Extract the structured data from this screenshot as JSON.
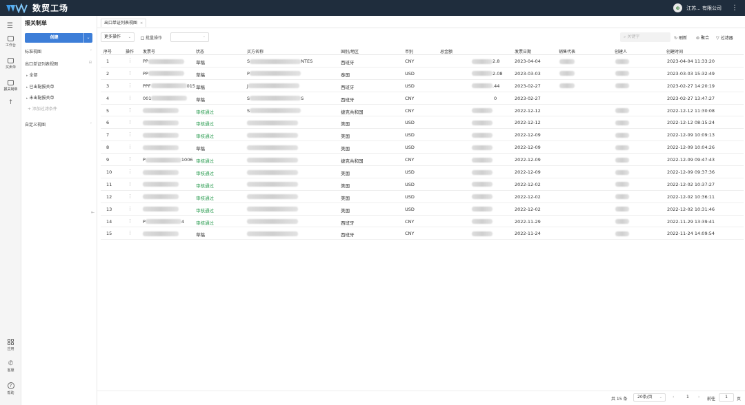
{
  "app": {
    "brand_name": "数贸工场",
    "avatar_glyph": "⊛",
    "company_name": "江苏... 有限公司",
    "colors": {
      "topbar": "#1f2d3d",
      "primary": "#3d7ed8",
      "approved": "#2f9e54"
    }
  },
  "iconbar": {
    "menu_icon": "hamburger-icon",
    "items": [
      {
        "label": "工作台",
        "icon": "workbench-icon"
      },
      {
        "label": "买卖单",
        "icon": "orders-icon"
      },
      {
        "label": "报关制单",
        "icon": "customs-icon"
      }
    ],
    "bottom": [
      {
        "label": "应用",
        "icon": "apps-grid-icon"
      },
      {
        "label": "客服",
        "icon": "phone-icon"
      },
      {
        "label": "帮助",
        "icon": "help-icon"
      }
    ]
  },
  "sidebar": {
    "title": "报关制单",
    "create_label": "创建",
    "standard_view": "标准视图",
    "export_view": "出口单证列表视图",
    "sub_items": [
      "全部",
      "已出配报关单",
      "未出配报关单"
    ],
    "add_filter": "+ 添加过滤条件",
    "custom_view": "自定义视图"
  },
  "tabs": [
    {
      "label": "出口单证列表视图",
      "close": "×"
    }
  ],
  "toolbar": {
    "more_ops": "更多操作",
    "batch_ops": "批量操作",
    "search_placeholder": "关键字",
    "refresh": "刷新",
    "stack": "聚合",
    "filter": "过滤器"
  },
  "table": {
    "columns": [
      "序号",
      "操作",
      "发票号",
      "状态",
      "买方名称",
      "国别/地区",
      "币别",
      "总金额",
      "发票日期",
      "销售代表",
      "创建人",
      "创建时间"
    ],
    "rows": [
      {
        "no": "1",
        "invoice": "PP",
        "status": "草稿",
        "approved": false,
        "buyer": "S",
        "buyer_tail": "NTES",
        "country": "西班牙",
        "currency": "CNY",
        "amount": "",
        "amount_tail": "2.8",
        "date": "2023-04-04",
        "rep": true,
        "creator": true,
        "created": "2023-04-04 11:33:20"
      },
      {
        "no": "2",
        "invoice": "PP",
        "status": "草稿",
        "approved": false,
        "buyer": "P",
        "buyer_tail": "",
        "country": "泰国",
        "currency": "USD",
        "amount": "",
        "amount_tail": "2.08",
        "date": "2023-03-03",
        "rep": true,
        "creator": true,
        "created": "2023-03-03 15:32:49"
      },
      {
        "no": "3",
        "invoice": "PPF",
        "invoice_tail": "015",
        "status": "草稿",
        "approved": false,
        "buyer": "J",
        "buyer_tail": "",
        "country": "西班牙",
        "currency": "USD",
        "amount": "",
        "amount_tail": ".44",
        "date": "2023-02-27",
        "rep": true,
        "creator": true,
        "created": "2023-02-27 14:20:19"
      },
      {
        "no": "4",
        "invoice": "001",
        "status": "草稿",
        "approved": false,
        "buyer": "S",
        "buyer_tail": "S",
        "country": "西班牙",
        "currency": "CNY",
        "amount": "0",
        "date": "2023-02-27",
        "rep": false,
        "creator": false,
        "created": "2023-02-27 13:47:27"
      },
      {
        "no": "5",
        "invoice": "",
        "status": "审核通过",
        "approved": true,
        "buyer": "S",
        "buyer_tail": "",
        "country": "捷克共和国",
        "currency": "CNY",
        "amount": "",
        "date": "2022-12-12",
        "rep": false,
        "creator": true,
        "created": "2022-12-12 11:30:08"
      },
      {
        "no": "6",
        "invoice": "",
        "status": "审核通过",
        "approved": true,
        "buyer": "",
        "buyer_tail": "",
        "country": "美国",
        "currency": "USD",
        "amount": "",
        "date": "2022-12-12",
        "rep": false,
        "creator": true,
        "created": "2022-12-12 08:15:24"
      },
      {
        "no": "7",
        "invoice": "",
        "status": "审核通过",
        "approved": true,
        "buyer": "",
        "buyer_tail": "",
        "country": "美国",
        "currency": "USD",
        "amount": "",
        "date": "2022-12-09",
        "rep": false,
        "creator": true,
        "created": "2022-12-09 10:09:13"
      },
      {
        "no": "8",
        "invoice": "",
        "status": "草稿",
        "approved": false,
        "buyer": "",
        "buyer_tail": "",
        "country": "美国",
        "currency": "USD",
        "amount": "",
        "date": "2022-12-09",
        "rep": false,
        "creator": true,
        "created": "2022-12-09 10:04:26"
      },
      {
        "no": "9",
        "invoice": "P",
        "invoice_tail": "1006",
        "status": "审核通过",
        "approved": true,
        "buyer": "",
        "buyer_tail": "",
        "country": "捷克共和国",
        "currency": "CNY",
        "amount": "",
        "date": "2022-12-09",
        "rep": false,
        "creator": true,
        "created": "2022-12-09 09:47:43"
      },
      {
        "no": "10",
        "invoice": "",
        "status": "审核通过",
        "approved": true,
        "buyer": "",
        "buyer_tail": "",
        "country": "美国",
        "currency": "USD",
        "amount": "",
        "date": "2022-12-09",
        "rep": false,
        "creator": true,
        "created": "2022-12-09 09:37:36"
      },
      {
        "no": "11",
        "invoice": "",
        "status": "审核通过",
        "approved": true,
        "buyer": "",
        "buyer_tail": "",
        "country": "美国",
        "currency": "USD",
        "amount": "",
        "date": "2022-12-02",
        "rep": false,
        "creator": true,
        "created": "2022-12-02 10:37:27"
      },
      {
        "no": "12",
        "invoice": "",
        "status": "审核通过",
        "approved": true,
        "buyer": "",
        "buyer_tail": "",
        "country": "美国",
        "currency": "USD",
        "amount": "",
        "date": "2022-12-02",
        "rep": false,
        "creator": true,
        "created": "2022-12-02 10:36:11"
      },
      {
        "no": "13",
        "invoice": "",
        "status": "审核通过",
        "approved": true,
        "buyer": "",
        "buyer_tail": "",
        "country": "美国",
        "currency": "USD",
        "amount": "",
        "date": "2022-12-02",
        "rep": false,
        "creator": true,
        "created": "2022-12-02 10:31:46"
      },
      {
        "no": "14",
        "invoice": "P",
        "invoice_tail": "4",
        "status": "审核通过",
        "approved": true,
        "buyer": "",
        "buyer_tail": "",
        "country": "西班牙",
        "currency": "CNY",
        "amount": "",
        "date": "2022-11-29",
        "rep": false,
        "creator": true,
        "created": "2022-11-29 13:39:41"
      },
      {
        "no": "15",
        "invoice": "",
        "status": "草稿",
        "approved": false,
        "buyer": "",
        "buyer_tail": "",
        "country": "西班牙",
        "currency": "CNY",
        "amount": "",
        "date": "2022-11-24",
        "rep": false,
        "creator": true,
        "created": "2022-11-24 14:09:54"
      }
    ]
  },
  "pagination": {
    "total": "共 15 条",
    "page_size": "20条/页",
    "prev": "‹",
    "current": "1",
    "next": "›",
    "goto_label": "前往",
    "goto_value": "1",
    "page_suffix": "页"
  }
}
